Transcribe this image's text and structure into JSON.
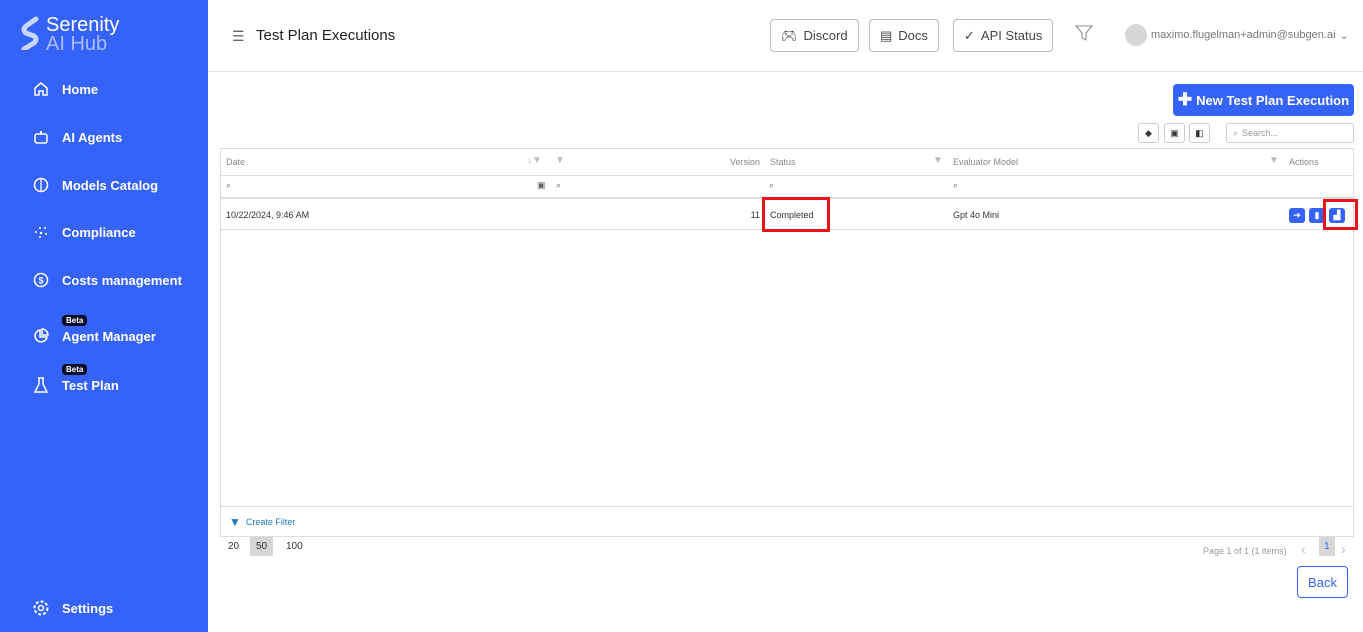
{
  "app": {
    "name_line1": "Serenity",
    "name_line2": "AI Hub"
  },
  "sidebar": {
    "items": [
      {
        "label": "Home",
        "icon": "home-icon"
      },
      {
        "label": "AI Agents",
        "icon": "robot-icon"
      },
      {
        "label": "Models Catalog",
        "icon": "brain-icon"
      },
      {
        "label": "Compliance",
        "icon": "dots-icon"
      },
      {
        "label": "Costs management",
        "icon": "dollar-icon"
      },
      {
        "label": "Agent Manager",
        "icon": "pie-chart-icon",
        "badge": "Beta"
      },
      {
        "label": "Test Plan",
        "icon": "flask-icon",
        "badge": "Beta"
      }
    ],
    "settings": "Settings"
  },
  "header": {
    "title": "Test Plan Executions",
    "discord": "Discord",
    "docs": "Docs",
    "api_status": "API Status",
    "user": "maximo.flugelman+admin@subgen.ai"
  },
  "toolbar": {
    "new_button": "New Test Plan Execution",
    "search_placeholder": "Search..."
  },
  "table": {
    "columns": [
      "Date",
      "Version",
      "Status",
      "Evaluator Model",
      "Actions"
    ],
    "rows": [
      {
        "date": "10/22/2024, 9:46 AM",
        "version": "11",
        "status": "Completed",
        "model": "Gpt 4o Mini"
      }
    ],
    "create_filter": "Create Filter"
  },
  "pagination": {
    "sizes": [
      "20",
      "50",
      "100"
    ],
    "selected_size": "50",
    "info": "Page 1 of 1 (1 items)",
    "current_page": "1"
  },
  "back": "Back",
  "colors": {
    "accent": "#3563f8",
    "highlight": "#e8141c"
  }
}
